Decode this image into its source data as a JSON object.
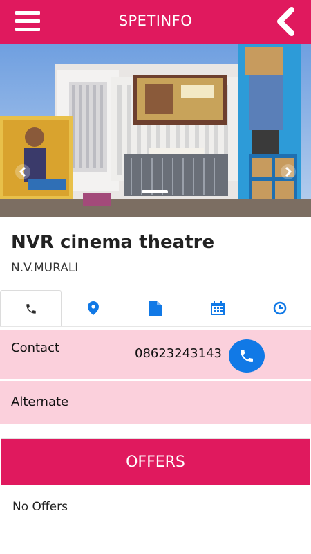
{
  "app": {
    "title": "SPETINFO",
    "menu_icon": "hamburger-menu-icon",
    "back_icon": "chevron-left-icon",
    "accent_color": "#e0195e"
  },
  "banner": {
    "slide_count_hint": 1,
    "prev_icon": "chevron-left-icon",
    "next_icon": "chevron-right-icon"
  },
  "place": {
    "name": "NVR cinema theatre",
    "owner": "N.V.MURALI"
  },
  "tabs": [
    {
      "icon": "phone-icon",
      "active": true
    },
    {
      "icon": "map-marker-icon",
      "active": false
    },
    {
      "icon": "document-icon",
      "active": false
    },
    {
      "icon": "calendar-icon",
      "active": false
    },
    {
      "icon": "clock-icon",
      "active": false
    }
  ],
  "contact": {
    "label": "Contact",
    "number": "08623243143",
    "call_icon": "phone-icon",
    "alternate_label": "Alternate",
    "row_color": "#fbd0dc",
    "call_color": "#1179e6"
  },
  "offers": {
    "header": "OFFERS",
    "empty_text": "No Offers"
  }
}
